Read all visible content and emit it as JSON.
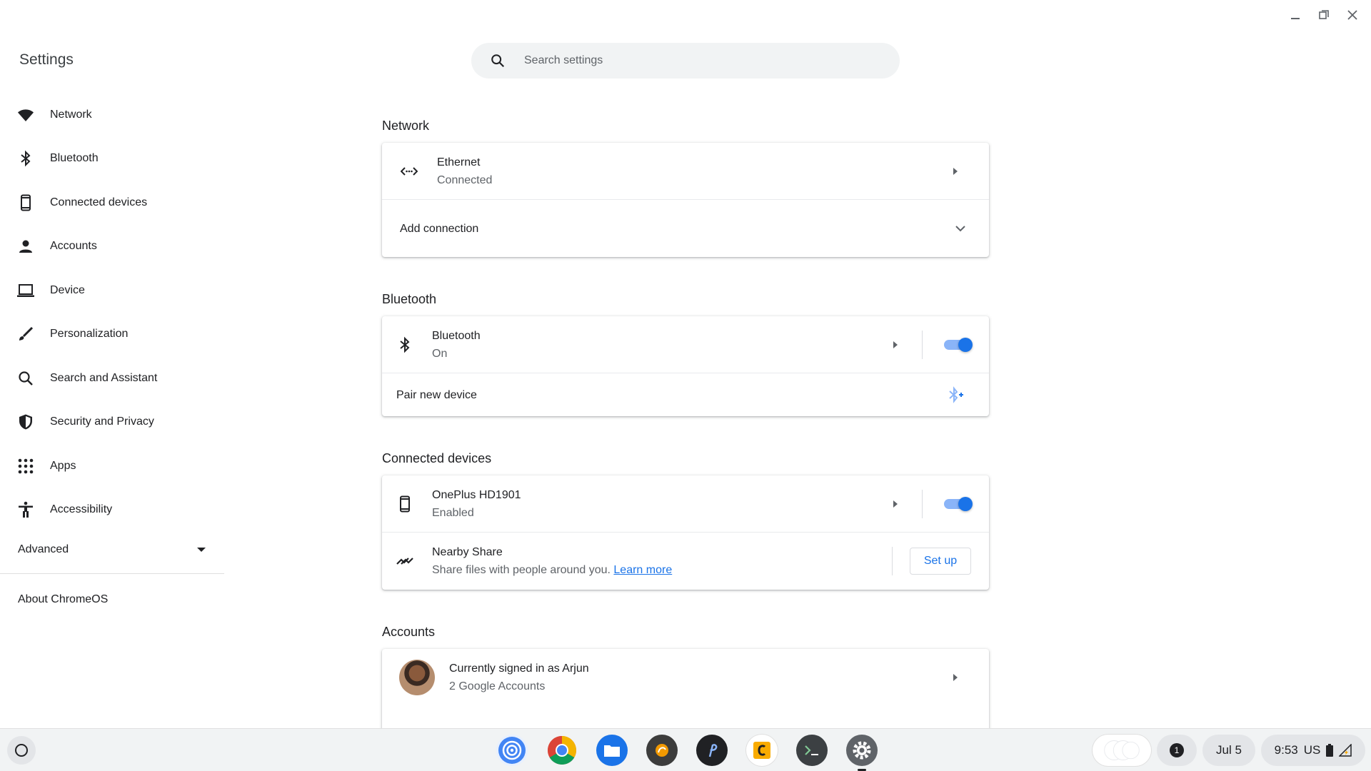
{
  "window": {
    "minimize_icon": "minimize-icon",
    "restore_icon": "restore-icon",
    "close_icon": "close-icon"
  },
  "sidebar": {
    "title": "Settings",
    "items": [
      {
        "label": "Network",
        "icon": "wifi-icon"
      },
      {
        "label": "Bluetooth",
        "icon": "bluetooth-icon"
      },
      {
        "label": "Connected devices",
        "icon": "phone-icon"
      },
      {
        "label": "Accounts",
        "icon": "person-icon"
      },
      {
        "label": "Device",
        "icon": "laptop-icon"
      },
      {
        "label": "Personalization",
        "icon": "brush-icon"
      },
      {
        "label": "Search and Assistant",
        "icon": "search-icon"
      },
      {
        "label": "Security and Privacy",
        "icon": "shield-icon"
      },
      {
        "label": "Apps",
        "icon": "apps-grid-icon"
      },
      {
        "label": "Accessibility",
        "icon": "accessibility-icon"
      }
    ],
    "advanced": "Advanced",
    "about": "About ChromeOS"
  },
  "search": {
    "placeholder": "Search settings"
  },
  "sections": {
    "network": {
      "title": "Network",
      "ethernet": {
        "name": "Ethernet",
        "status": "Connected"
      },
      "add_connection": "Add connection"
    },
    "bluetooth": {
      "title": "Bluetooth",
      "row": {
        "name": "Bluetooth",
        "status": "On",
        "enabled": true
      },
      "pair": "Pair new device"
    },
    "connected_devices": {
      "title": "Connected devices",
      "phone": {
        "name": "OnePlus HD1901",
        "status": "Enabled",
        "enabled": true
      },
      "nearby": {
        "name": "Nearby Share",
        "description": "Share files with people around you.",
        "link": "Learn more",
        "button": "Set up"
      }
    },
    "accounts": {
      "title": "Accounts",
      "signed_in": "Currently signed in as Arjun",
      "count": "2 Google Accounts"
    }
  },
  "shelf": {
    "apps": [
      "podcast-icon",
      "chrome-icon",
      "files-icon",
      "app-icon",
      "app-icon",
      "app-icon",
      "terminal-icon",
      "settings-icon"
    ],
    "notification_count": "1",
    "date": "Jul 5",
    "time": "9:53",
    "locale": "US"
  },
  "colors": {
    "accent": "#1a73e8",
    "toggle_track": "#8ab4f8",
    "text": "#202124",
    "secondary": "#5f6368"
  }
}
